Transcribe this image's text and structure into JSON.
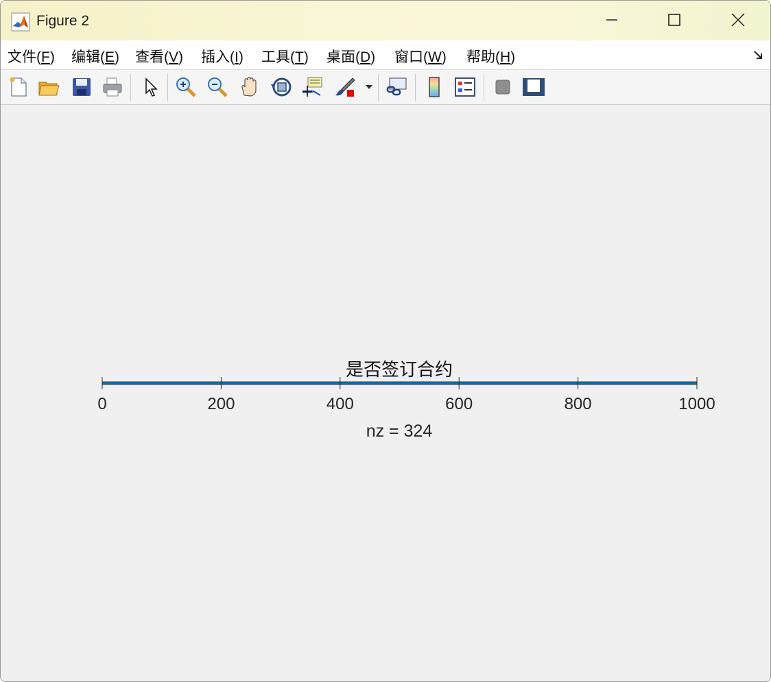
{
  "window": {
    "title": "Figure 2"
  },
  "menu": [
    {
      "text": "文件(",
      "key": "F",
      "end": ")"
    },
    {
      "text": "编辑(",
      "key": "E",
      "end": ")"
    },
    {
      "text": "查看(",
      "key": "V",
      "end": ")"
    },
    {
      "text": "插入(",
      "key": "I",
      "end": ")"
    },
    {
      "text": "工具(",
      "key": "T",
      "end": ")"
    },
    {
      "text": "桌面(",
      "key": "D",
      "end": ")"
    },
    {
      "text": "窗口(",
      "key": "W",
      "end": ")"
    },
    {
      "text": "帮助(",
      "key": "H",
      "end": ")"
    }
  ],
  "toolbar_icons": [
    "new-figure-icon",
    "open-file-icon",
    "save-icon",
    "print-icon",
    "select-pointer-icon",
    "zoom-in-icon",
    "zoom-out-icon",
    "pan-hand-icon",
    "rotate-3d-icon",
    "data-cursor-icon",
    "brush-icon",
    "brush-dropdown-icon",
    "link-plot-icon",
    "colorbar-icon",
    "legend-icon",
    "hide-plot-tools-icon",
    "show-plot-tools-icon"
  ],
  "chart_data": {
    "type": "spy",
    "title": "是否签订合约",
    "xlabel": "nz = 324",
    "xlim": [
      0,
      1000
    ],
    "xticks": [
      0,
      200,
      400,
      600,
      800,
      1000
    ],
    "tick_labels": [
      "0",
      "200",
      "400",
      "600",
      "800",
      "1000"
    ],
    "rows": 1,
    "nonzero_count": 324,
    "marker_color": "#0072bd"
  }
}
